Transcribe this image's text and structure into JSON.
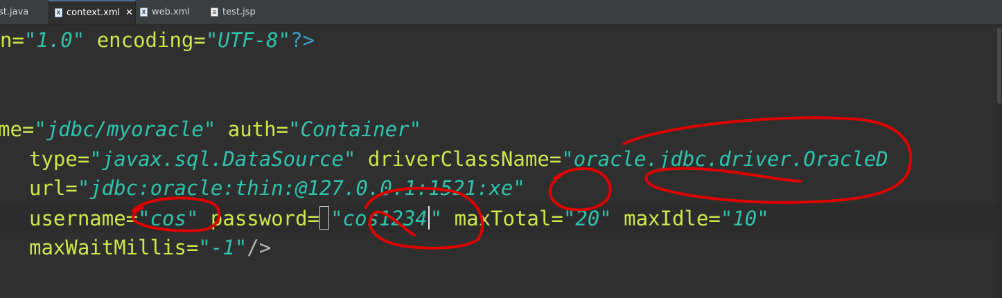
{
  "tabs": [
    {
      "label": "est.java",
      "icon": "java-file-icon"
    },
    {
      "label": "context.xml",
      "icon": "xml-file-icon",
      "active": true,
      "close": "✕"
    },
    {
      "label": "web.xml",
      "icon": "xml-file-icon"
    },
    {
      "label": "test.jsp",
      "icon": "jsp-file-icon"
    }
  ],
  "code": {
    "line1": {
      "a": "n=",
      "b": "\"1.0\"",
      "c": " encoding=",
      "d": "\"UTF-8\"",
      "e": "?>"
    },
    "line4": {
      "a": "me=",
      "b": "\"jdbc/myoracle\"",
      "c": " auth=",
      "d": "\"Container\""
    },
    "line5": {
      "a": "type=",
      "b": "\"javax.sql.DataSource\"",
      "c": " driverClassName=",
      "d": "\"oracle.jdbc.driver.OracleD"
    },
    "line6": {
      "a": "url=",
      "b": "\"jdbc:oracle:thin:@127.0.0.1:1521:xe\""
    },
    "line7": {
      "a": "username=",
      "b": "\"cos\"",
      "c": " password=",
      "d1": "\"",
      "d2": "cos1234",
      "d3": "\"",
      "e": " maxTotal=",
      "f": "\"20\"",
      "g": " maxIdle=",
      "h": "\"10\""
    },
    "line8": {
      "a": "maxWaitMillis=",
      "b": "\"-1\"",
      "c": "/>"
    }
  },
  "colors": {
    "background": "#2f2f2f",
    "attribute": "#cbe84a",
    "string": "#2fc3ad",
    "processing_instruction": "#3d9fc9",
    "annotation": "#e00000"
  }
}
